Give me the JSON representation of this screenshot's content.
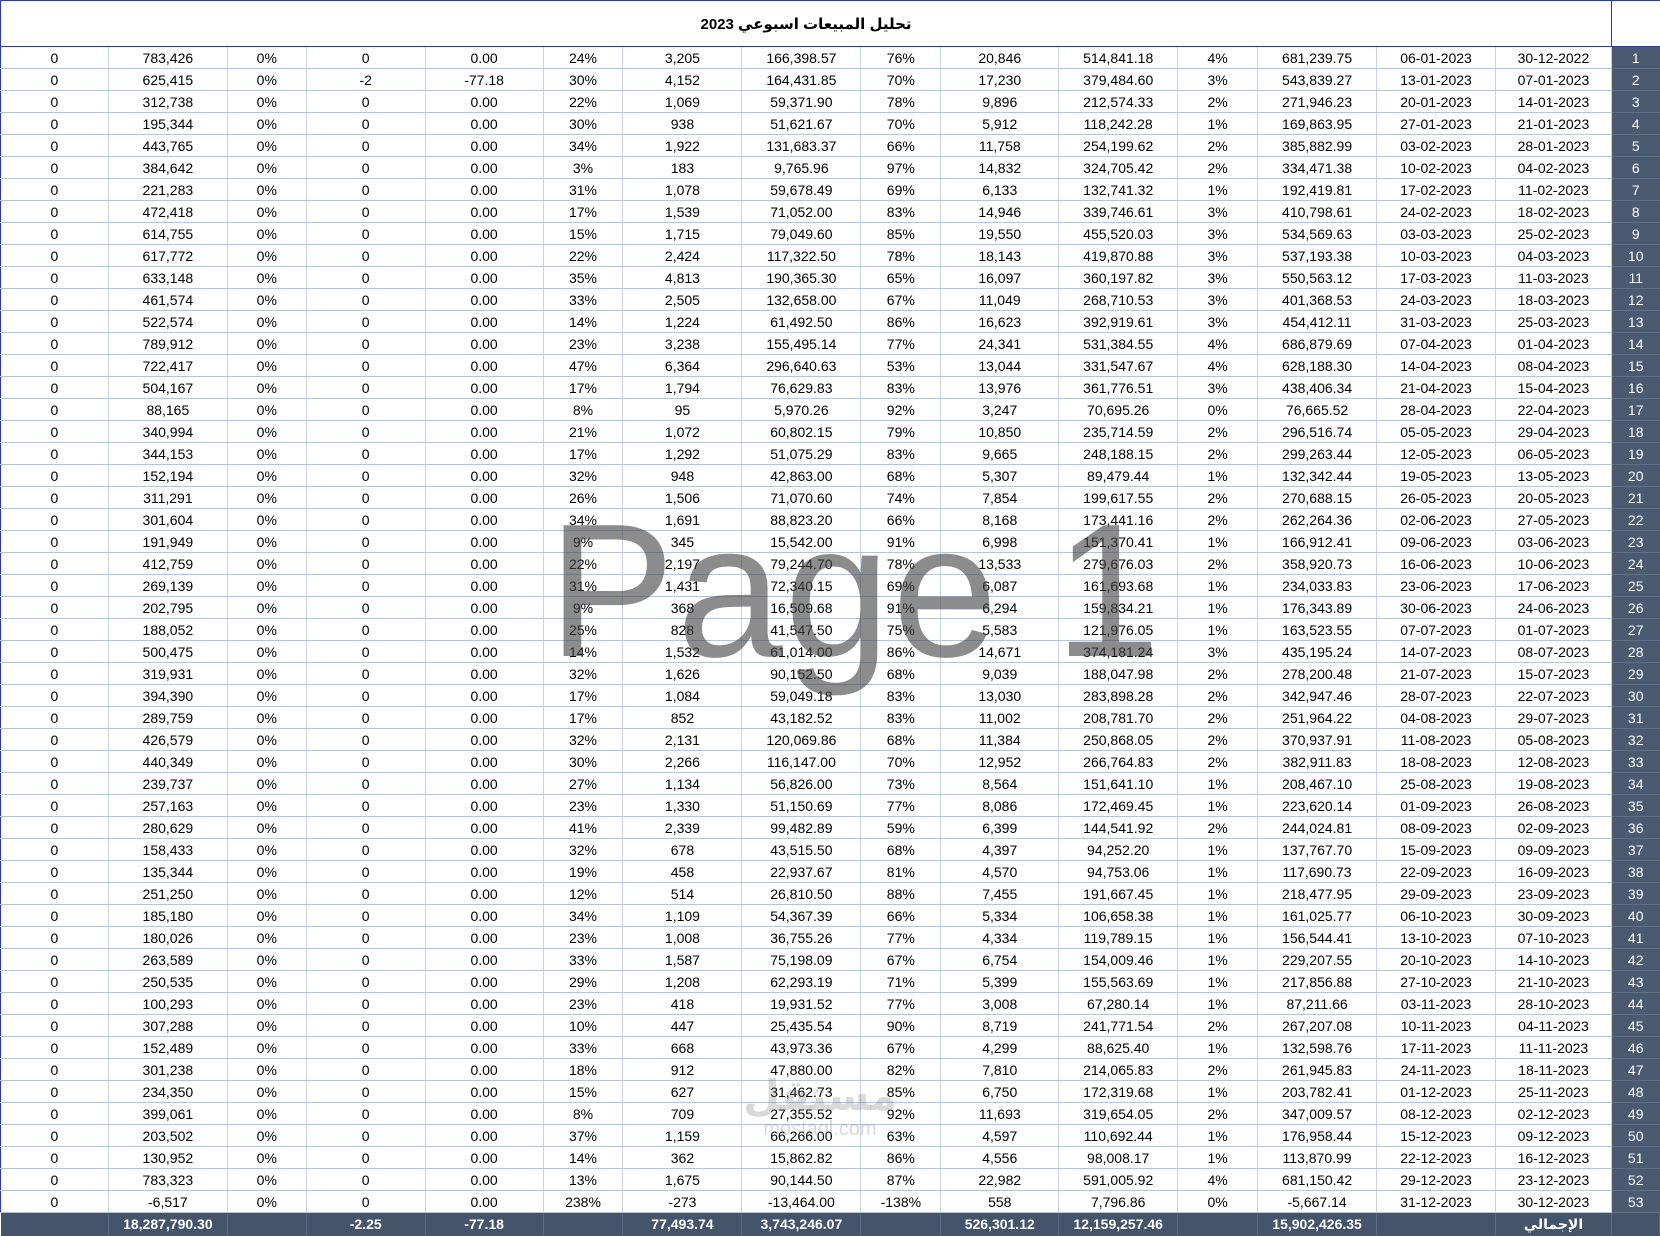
{
  "title": "تحليل المبيعات اسبوعي 2023",
  "watermark": "Page 1",
  "logo": {
    "mark": "مستقل",
    "sub": "mostaql.com"
  },
  "columns": [
    "col_a",
    "col_b",
    "col_c",
    "col_d",
    "col_e",
    "col_f",
    "col_g",
    "col_h",
    "col_i",
    "col_j",
    "col_k",
    "col_l",
    "col_m",
    "col_n",
    "col_o",
    "row_number"
  ],
  "rows": [
    [
      "0",
      "783,426",
      "0%",
      "0",
      "0.00",
      "24%",
      "3,205",
      "166,398.57",
      "76%",
      "20,846",
      "514,841.18",
      "4%",
      "681,239.75",
      "06-01-2023",
      "30-12-2022",
      "1"
    ],
    [
      "0",
      "625,415",
      "0%",
      "-2",
      "-77.18",
      "30%",
      "4,152",
      "164,431.85",
      "70%",
      "17,230",
      "379,484.60",
      "3%",
      "543,839.27",
      "13-01-2023",
      "07-01-2023",
      "2"
    ],
    [
      "0",
      "312,738",
      "0%",
      "0",
      "0.00",
      "22%",
      "1,069",
      "59,371.90",
      "78%",
      "9,896",
      "212,574.33",
      "2%",
      "271,946.23",
      "20-01-2023",
      "14-01-2023",
      "3"
    ],
    [
      "0",
      "195,344",
      "0%",
      "0",
      "0.00",
      "30%",
      "938",
      "51,621.67",
      "70%",
      "5,912",
      "118,242.28",
      "1%",
      "169,863.95",
      "27-01-2023",
      "21-01-2023",
      "4"
    ],
    [
      "0",
      "443,765",
      "0%",
      "0",
      "0.00",
      "34%",
      "1,922",
      "131,683.37",
      "66%",
      "11,758",
      "254,199.62",
      "2%",
      "385,882.99",
      "03-02-2023",
      "28-01-2023",
      "5"
    ],
    [
      "0",
      "384,642",
      "0%",
      "0",
      "0.00",
      "3%",
      "183",
      "9,765.96",
      "97%",
      "14,832",
      "324,705.42",
      "2%",
      "334,471.38",
      "10-02-2023",
      "04-02-2023",
      "6"
    ],
    [
      "0",
      "221,283",
      "0%",
      "0",
      "0.00",
      "31%",
      "1,078",
      "59,678.49",
      "69%",
      "6,133",
      "132,741.32",
      "1%",
      "192,419.81",
      "17-02-2023",
      "11-02-2023",
      "7"
    ],
    [
      "0",
      "472,418",
      "0%",
      "0",
      "0.00",
      "17%",
      "1,539",
      "71,052.00",
      "83%",
      "14,946",
      "339,746.61",
      "3%",
      "410,798.61",
      "24-02-2023",
      "18-02-2023",
      "8"
    ],
    [
      "0",
      "614,755",
      "0%",
      "0",
      "0.00",
      "15%",
      "1,715",
      "79,049.60",
      "85%",
      "19,550",
      "455,520.03",
      "3%",
      "534,569.63",
      "03-03-2023",
      "25-02-2023",
      "9"
    ],
    [
      "0",
      "617,772",
      "0%",
      "0",
      "0.00",
      "22%",
      "2,424",
      "117,322.50",
      "78%",
      "18,143",
      "419,870.88",
      "3%",
      "537,193.38",
      "10-03-2023",
      "04-03-2023",
      "10"
    ],
    [
      "0",
      "633,148",
      "0%",
      "0",
      "0.00",
      "35%",
      "4,813",
      "190,365.30",
      "65%",
      "16,097",
      "360,197.82",
      "3%",
      "550,563.12",
      "17-03-2023",
      "11-03-2023",
      "11"
    ],
    [
      "0",
      "461,574",
      "0%",
      "0",
      "0.00",
      "33%",
      "2,505",
      "132,658.00",
      "67%",
      "11,049",
      "268,710.53",
      "3%",
      "401,368.53",
      "24-03-2023",
      "18-03-2023",
      "12"
    ],
    [
      "0",
      "522,574",
      "0%",
      "0",
      "0.00",
      "14%",
      "1,224",
      "61,492.50",
      "86%",
      "16,623",
      "392,919.61",
      "3%",
      "454,412.11",
      "31-03-2023",
      "25-03-2023",
      "13"
    ],
    [
      "0",
      "789,912",
      "0%",
      "0",
      "0.00",
      "23%",
      "3,238",
      "155,495.14",
      "77%",
      "24,341",
      "531,384.55",
      "4%",
      "686,879.69",
      "07-04-2023",
      "01-04-2023",
      "14"
    ],
    [
      "0",
      "722,417",
      "0%",
      "0",
      "0.00",
      "47%",
      "6,364",
      "296,640.63",
      "53%",
      "13,044",
      "331,547.67",
      "4%",
      "628,188.30",
      "14-04-2023",
      "08-04-2023",
      "15"
    ],
    [
      "0",
      "504,167",
      "0%",
      "0",
      "0.00",
      "17%",
      "1,794",
      "76,629.83",
      "83%",
      "13,976",
      "361,776.51",
      "3%",
      "438,406.34",
      "21-04-2023",
      "15-04-2023",
      "16"
    ],
    [
      "0",
      "88,165",
      "0%",
      "0",
      "0.00",
      "8%",
      "95",
      "5,970.26",
      "92%",
      "3,247",
      "70,695.26",
      "0%",
      "76,665.52",
      "28-04-2023",
      "22-04-2023",
      "17"
    ],
    [
      "0",
      "340,994",
      "0%",
      "0",
      "0.00",
      "21%",
      "1,072",
      "60,802.15",
      "79%",
      "10,850",
      "235,714.59",
      "2%",
      "296,516.74",
      "05-05-2023",
      "29-04-2023",
      "18"
    ],
    [
      "0",
      "344,153",
      "0%",
      "0",
      "0.00",
      "17%",
      "1,292",
      "51,075.29",
      "83%",
      "9,665",
      "248,188.15",
      "2%",
      "299,263.44",
      "12-05-2023",
      "06-05-2023",
      "19"
    ],
    [
      "0",
      "152,194",
      "0%",
      "0",
      "0.00",
      "32%",
      "948",
      "42,863.00",
      "68%",
      "5,307",
      "89,479.44",
      "1%",
      "132,342.44",
      "19-05-2023",
      "13-05-2023",
      "20"
    ],
    [
      "0",
      "311,291",
      "0%",
      "0",
      "0.00",
      "26%",
      "1,506",
      "71,070.60",
      "74%",
      "7,854",
      "199,617.55",
      "2%",
      "270,688.15",
      "26-05-2023",
      "20-05-2023",
      "21"
    ],
    [
      "0",
      "301,604",
      "0%",
      "0",
      "0.00",
      "34%",
      "1,691",
      "88,823.20",
      "66%",
      "8,168",
      "173,441.16",
      "2%",
      "262,264.36",
      "02-06-2023",
      "27-05-2023",
      "22"
    ],
    [
      "0",
      "191,949",
      "0%",
      "0",
      "0.00",
      "9%",
      "345",
      "15,542.00",
      "91%",
      "6,998",
      "151,370.41",
      "1%",
      "166,912.41",
      "09-06-2023",
      "03-06-2023",
      "23"
    ],
    [
      "0",
      "412,759",
      "0%",
      "0",
      "0.00",
      "22%",
      "2,197",
      "79,244.70",
      "78%",
      "13,533",
      "279,676.03",
      "2%",
      "358,920.73",
      "16-06-2023",
      "10-06-2023",
      "24"
    ],
    [
      "0",
      "269,139",
      "0%",
      "0",
      "0.00",
      "31%",
      "1,431",
      "72,340.15",
      "69%",
      "6,087",
      "161,693.68",
      "1%",
      "234,033.83",
      "23-06-2023",
      "17-06-2023",
      "25"
    ],
    [
      "0",
      "202,795",
      "0%",
      "0",
      "0.00",
      "9%",
      "368",
      "16,509.68",
      "91%",
      "6,294",
      "159,834.21",
      "1%",
      "176,343.89",
      "30-06-2023",
      "24-06-2023",
      "26"
    ],
    [
      "0",
      "188,052",
      "0%",
      "0",
      "0.00",
      "25%",
      "828",
      "41,547.50",
      "75%",
      "5,583",
      "121,976.05",
      "1%",
      "163,523.55",
      "07-07-2023",
      "01-07-2023",
      "27"
    ],
    [
      "0",
      "500,475",
      "0%",
      "0",
      "0.00",
      "14%",
      "1,532",
      "61,014.00",
      "86%",
      "14,671",
      "374,181.24",
      "3%",
      "435,195.24",
      "14-07-2023",
      "08-07-2023",
      "28"
    ],
    [
      "0",
      "319,931",
      "0%",
      "0",
      "0.00",
      "32%",
      "1,626",
      "90,152.50",
      "68%",
      "9,039",
      "188,047.98",
      "2%",
      "278,200.48",
      "21-07-2023",
      "15-07-2023",
      "29"
    ],
    [
      "0",
      "394,390",
      "0%",
      "0",
      "0.00",
      "17%",
      "1,084",
      "59,049.18",
      "83%",
      "13,030",
      "283,898.28",
      "2%",
      "342,947.46",
      "28-07-2023",
      "22-07-2023",
      "30"
    ],
    [
      "0",
      "289,759",
      "0%",
      "0",
      "0.00",
      "17%",
      "852",
      "43,182.52",
      "83%",
      "11,002",
      "208,781.70",
      "2%",
      "251,964.22",
      "04-08-2023",
      "29-07-2023",
      "31"
    ],
    [
      "0",
      "426,579",
      "0%",
      "0",
      "0.00",
      "32%",
      "2,131",
      "120,069.86",
      "68%",
      "11,384",
      "250,868.05",
      "2%",
      "370,937.91",
      "11-08-2023",
      "05-08-2023",
      "32"
    ],
    [
      "0",
      "440,349",
      "0%",
      "0",
      "0.00",
      "30%",
      "2,266",
      "116,147.00",
      "70%",
      "12,952",
      "266,764.83",
      "2%",
      "382,911.83",
      "18-08-2023",
      "12-08-2023",
      "33"
    ],
    [
      "0",
      "239,737",
      "0%",
      "0",
      "0.00",
      "27%",
      "1,134",
      "56,826.00",
      "73%",
      "8,564",
      "151,641.10",
      "1%",
      "208,467.10",
      "25-08-2023",
      "19-08-2023",
      "34"
    ],
    [
      "0",
      "257,163",
      "0%",
      "0",
      "0.00",
      "23%",
      "1,330",
      "51,150.69",
      "77%",
      "8,086",
      "172,469.45",
      "1%",
      "223,620.14",
      "01-09-2023",
      "26-08-2023",
      "35"
    ],
    [
      "0",
      "280,629",
      "0%",
      "0",
      "0.00",
      "41%",
      "2,339",
      "99,482.89",
      "59%",
      "6,399",
      "144,541.92",
      "2%",
      "244,024.81",
      "08-09-2023",
      "02-09-2023",
      "36"
    ],
    [
      "0",
      "158,433",
      "0%",
      "0",
      "0.00",
      "32%",
      "678",
      "43,515.50",
      "68%",
      "4,397",
      "94,252.20",
      "1%",
      "137,767.70",
      "15-09-2023",
      "09-09-2023",
      "37"
    ],
    [
      "0",
      "135,344",
      "0%",
      "0",
      "0.00",
      "19%",
      "458",
      "22,937.67",
      "81%",
      "4,570",
      "94,753.06",
      "1%",
      "117,690.73",
      "22-09-2023",
      "16-09-2023",
      "38"
    ],
    [
      "0",
      "251,250",
      "0%",
      "0",
      "0.00",
      "12%",
      "514",
      "26,810.50",
      "88%",
      "7,455",
      "191,667.45",
      "1%",
      "218,477.95",
      "29-09-2023",
      "23-09-2023",
      "39"
    ],
    [
      "0",
      "185,180",
      "0%",
      "0",
      "0.00",
      "34%",
      "1,109",
      "54,367.39",
      "66%",
      "5,334",
      "106,658.38",
      "1%",
      "161,025.77",
      "06-10-2023",
      "30-09-2023",
      "40"
    ],
    [
      "0",
      "180,026",
      "0%",
      "0",
      "0.00",
      "23%",
      "1,008",
      "36,755.26",
      "77%",
      "4,334",
      "119,789.15",
      "1%",
      "156,544.41",
      "13-10-2023",
      "07-10-2023",
      "41"
    ],
    [
      "0",
      "263,589",
      "0%",
      "0",
      "0.00",
      "33%",
      "1,587",
      "75,198.09",
      "67%",
      "6,754",
      "154,009.46",
      "1%",
      "229,207.55",
      "20-10-2023",
      "14-10-2023",
      "42"
    ],
    [
      "0",
      "250,535",
      "0%",
      "0",
      "0.00",
      "29%",
      "1,208",
      "62,293.19",
      "71%",
      "5,399",
      "155,563.69",
      "1%",
      "217,856.88",
      "27-10-2023",
      "21-10-2023",
      "43"
    ],
    [
      "0",
      "100,293",
      "0%",
      "0",
      "0.00",
      "23%",
      "418",
      "19,931.52",
      "77%",
      "3,008",
      "67,280.14",
      "1%",
      "87,211.66",
      "03-11-2023",
      "28-10-2023",
      "44"
    ],
    [
      "0",
      "307,288",
      "0%",
      "0",
      "0.00",
      "10%",
      "447",
      "25,435.54",
      "90%",
      "8,719",
      "241,771.54",
      "2%",
      "267,207.08",
      "10-11-2023",
      "04-11-2023",
      "45"
    ],
    [
      "0",
      "152,489",
      "0%",
      "0",
      "0.00",
      "33%",
      "668",
      "43,973.36",
      "67%",
      "4,299",
      "88,625.40",
      "1%",
      "132,598.76",
      "17-11-2023",
      "11-11-2023",
      "46"
    ],
    [
      "0",
      "301,238",
      "0%",
      "0",
      "0.00",
      "18%",
      "912",
      "47,880.00",
      "82%",
      "7,810",
      "214,065.83",
      "2%",
      "261,945.83",
      "24-11-2023",
      "18-11-2023",
      "47"
    ],
    [
      "0",
      "234,350",
      "0%",
      "0",
      "0.00",
      "15%",
      "627",
      "31,462.73",
      "85%",
      "6,750",
      "172,319.68",
      "1%",
      "203,782.41",
      "01-12-2023",
      "25-11-2023",
      "48"
    ],
    [
      "0",
      "399,061",
      "0%",
      "0",
      "0.00",
      "8%",
      "709",
      "27,355.52",
      "92%",
      "11,693",
      "319,654.05",
      "2%",
      "347,009.57",
      "08-12-2023",
      "02-12-2023",
      "49"
    ],
    [
      "0",
      "203,502",
      "0%",
      "0",
      "0.00",
      "37%",
      "1,159",
      "66,266.00",
      "63%",
      "4,597",
      "110,692.44",
      "1%",
      "176,958.44",
      "15-12-2023",
      "09-12-2023",
      "50"
    ],
    [
      "0",
      "130,952",
      "0%",
      "0",
      "0.00",
      "14%",
      "362",
      "15,862.82",
      "86%",
      "4,556",
      "98,008.17",
      "1%",
      "113,870.99",
      "22-12-2023",
      "16-12-2023",
      "51"
    ],
    [
      "0",
      "783,323",
      "0%",
      "0",
      "0.00",
      "13%",
      "1,675",
      "90,144.50",
      "87%",
      "22,982",
      "591,005.92",
      "4%",
      "681,150.42",
      "29-12-2023",
      "23-12-2023",
      "52"
    ],
    [
      "0",
      "-6,517",
      "0%",
      "0",
      "0.00",
      "238%",
      "-273",
      "-13,464.00",
      "-138%",
      "558",
      "7,796.86",
      "0%",
      "-5,667.14",
      "31-12-2023",
      "30-12-2023",
      "53"
    ]
  ],
  "totals": [
    "",
    "18,287,790.30",
    "",
    "-2.25",
    "-77.18",
    "",
    "77,493.74",
    "3,743,246.07",
    "",
    "526,301.12",
    "12,159,257.46",
    "",
    "15,902,426.35",
    "",
    "الإجمالي",
    ""
  ]
}
